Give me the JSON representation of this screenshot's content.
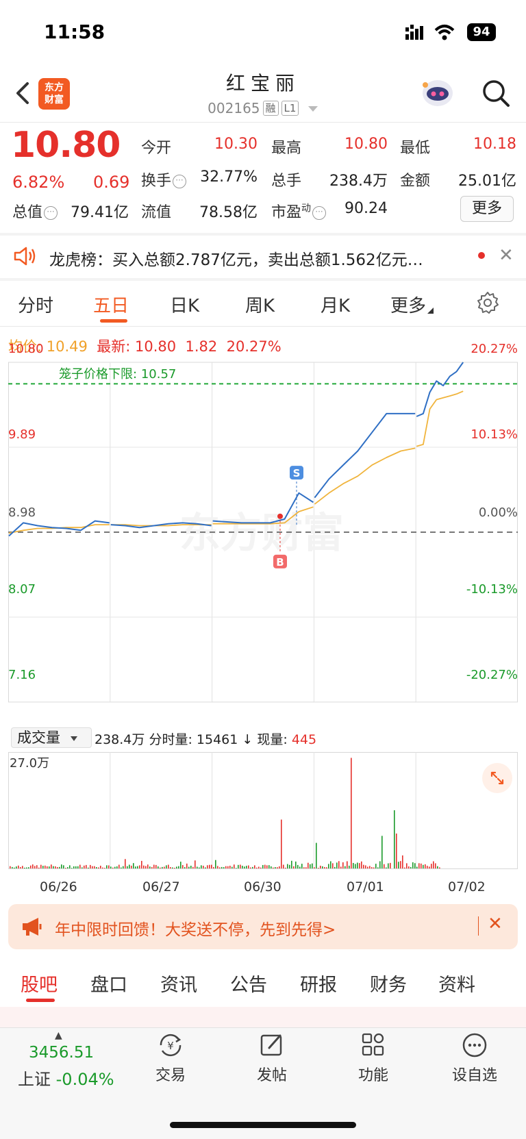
{
  "status_bar": {
    "time": "11:58",
    "battery": "94"
  },
  "header": {
    "logo_text_1": "东方",
    "logo_text_2": "财富",
    "stock_name": "红宝丽",
    "stock_code": "002165",
    "tag_margin": "融",
    "tag_level": "L1"
  },
  "quote": {
    "price": "10.80",
    "change_pct": "6.82%",
    "change_amt": "0.69",
    "open_label": "今开",
    "open": "10.30",
    "high_label": "最高",
    "high": "10.80",
    "low_label": "最低",
    "low": "10.18",
    "turnover_label": "换手",
    "turnover": "32.77%",
    "volume_label": "总手",
    "volume": "238.4万",
    "amount_label": "金额",
    "amount": "25.01亿",
    "mktcap_label": "总值",
    "mktcap": "79.41亿",
    "float_label": "流值",
    "float_cap": "78.58亿",
    "pe_label": "市盈",
    "pe_sup": "动",
    "pe": "90.24",
    "more_button": "更多"
  },
  "notice": {
    "text": "龙虎榜：买入总额2.787亿元，卖出总额1.562亿元…",
    "close": "✕"
  },
  "chart_tabs": {
    "items": [
      "分时",
      "五日",
      "日K",
      "周K",
      "月K",
      "更多"
    ],
    "active": "五日"
  },
  "chart_info": {
    "avg_label": "均价:",
    "avg": "10.49",
    "last_label": "最新:",
    "last": "10.80",
    "chg": "1.82",
    "chg_pct": "20.27%"
  },
  "chart_data": {
    "type": "line",
    "title": "",
    "days": [
      "06/26",
      "06/27",
      "06/30",
      "07/01",
      "07/02"
    ],
    "y_axis_left": [
      "10.80",
      "9.89",
      "8.98",
      "8.07",
      "7.16"
    ],
    "y_axis_right": [
      "20.27%",
      "10.13%",
      "0.00%",
      "-10.13%",
      "-20.27%"
    ],
    "ylim": [
      7.16,
      10.8
    ],
    "prev_close": 8.98,
    "cage_limit_label": "笼子价格下限:",
    "cage_limit": "10.57",
    "marker_buy": "B",
    "marker_sell": "S",
    "series": [
      {
        "name": "price",
        "color": "#2f6fc4",
        "values": [
          8.94,
          9.08,
          9.05,
          9.03,
          9.02,
          9.0,
          9.1,
          9.08,
          9.06,
          9.05,
          9.03,
          9.05,
          9.07,
          9.08,
          9.07,
          9.05,
          9.1,
          9.09,
          9.08,
          9.08,
          9.08,
          9.12,
          9.4,
          9.3,
          9.35,
          9.55,
          9.7,
          9.85,
          10.05,
          10.25,
          10.25,
          10.25,
          10.22,
          10.25,
          10.48,
          10.6,
          10.55,
          10.65,
          10.7,
          10.8
        ]
      },
      {
        "name": "avg",
        "color": "#f0b43c",
        "values": [
          8.97,
          9.0,
          9.02,
          9.02,
          9.03,
          9.03,
          9.06,
          9.06,
          9.06,
          9.06,
          9.05,
          9.05,
          9.05,
          9.06,
          9.06,
          9.06,
          9.07,
          9.07,
          9.07,
          9.07,
          9.07,
          9.08,
          9.2,
          9.25,
          9.28,
          9.4,
          9.5,
          9.58,
          9.7,
          9.78,
          9.85,
          9.88,
          9.9,
          9.92,
          10.3,
          10.4,
          10.42,
          10.44,
          10.46,
          10.49
        ]
      }
    ]
  },
  "volume": {
    "selector": "成交量",
    "total": "238.4万",
    "minute_label": "分时量:",
    "minute": "15461",
    "arrow": "↓",
    "current_label": "现量:",
    "current": "445",
    "max_label": "27.0万"
  },
  "promo": {
    "text": "年中限时回馈！大奖送不停，先到先得>",
    "close": "✕"
  },
  "bottom_tabs": {
    "items": [
      "股吧",
      "盘口",
      "资讯",
      "公告",
      "研报",
      "财务",
      "资料"
    ],
    "active": "股吧"
  },
  "bottom_nav": {
    "index_value": "3456.51",
    "index_name": "上证",
    "index_change": "-0.04%",
    "items": [
      "交易",
      "发帖",
      "功能",
      "设自选"
    ]
  },
  "colors": {
    "up": "#e5302b",
    "down": "#1a9a2a",
    "accent": "#f25a22",
    "price_line": "#2f6fc4",
    "avg_line": "#f0b43c"
  }
}
